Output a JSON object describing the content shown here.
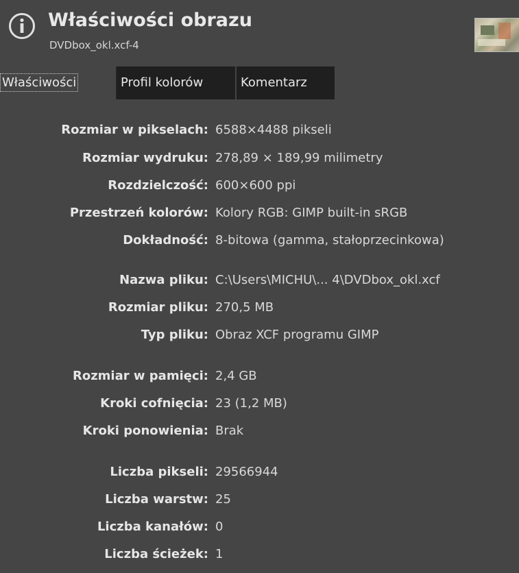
{
  "header": {
    "title": "Właściwości obrazu",
    "subtitle": "DVDbox_okl.xcf-4",
    "icon": "info-icon"
  },
  "tabs": [
    {
      "label": "Właściwości",
      "active": true
    },
    {
      "label": "Profil kolorów",
      "active": false
    },
    {
      "label": "Komentarz",
      "active": false
    }
  ],
  "properties": [
    {
      "label": "Rozmiar w pikselach:",
      "value": "6588×4488 pikseli"
    },
    {
      "label": "Rozmiar wydruku:",
      "value": "278,89 × 189,99 milimetry"
    },
    {
      "label": "Rozdzielczość:",
      "value": "600×600 ppi"
    },
    {
      "label": "Przestrzeń kolorów:",
      "value": "Kolory RGB: GIMP built-in sRGB"
    },
    {
      "label": "Dokładność:",
      "value": "8-bitowa (gamma, stałoprzecinkowa)"
    },
    {
      "label": "Nazwa pliku:",
      "value": "C:\\Users\\MICHU\\... 4\\DVDbox_okl.xcf"
    },
    {
      "label": "Rozmiar pliku:",
      "value": "270,5 MB"
    },
    {
      "label": "Typ pliku:",
      "value": "Obraz XCF programu GIMP"
    },
    {
      "label": "Rozmiar w pamięci:",
      "value": "2,4 GB"
    },
    {
      "label": "Kroki cofnięcia:",
      "value": "23 (1,2 MB)"
    },
    {
      "label": "Kroki ponowienia:",
      "value": "Brak"
    },
    {
      "label": "Liczba pikseli:",
      "value": "29566944"
    },
    {
      "label": "Liczba warstw:",
      "value": "25"
    },
    {
      "label": "Liczba kanałów:",
      "value": "0"
    },
    {
      "label": "Liczba ścieżek:",
      "value": "1"
    }
  ],
  "colors": {
    "background": "#454545",
    "inactive_tab": "#1f1f1f",
    "text": "#dcdcdc"
  }
}
